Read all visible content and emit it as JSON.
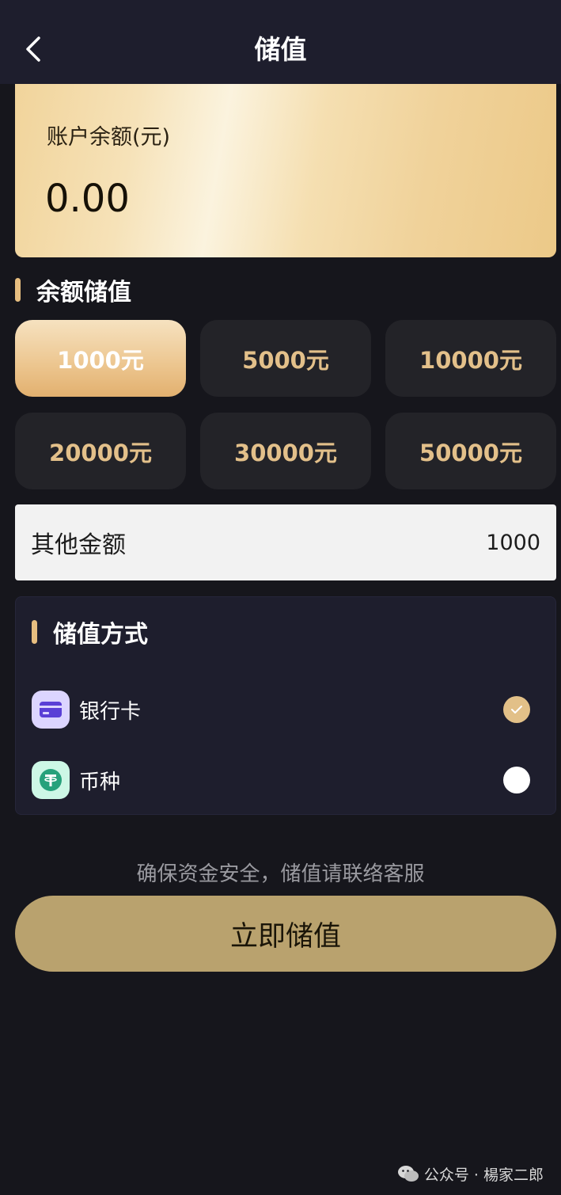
{
  "header": {
    "title": "储值",
    "back_icon": "chevron-left-icon"
  },
  "balance": {
    "label": "账户余额(元)",
    "value": "0.00"
  },
  "recharge_section": {
    "title": "余额储值",
    "amounts": [
      {
        "label": "1000元",
        "selected": true
      },
      {
        "label": "5000元",
        "selected": false
      },
      {
        "label": "10000元",
        "selected": false
      },
      {
        "label": "20000元",
        "selected": false
      },
      {
        "label": "30000元",
        "selected": false
      },
      {
        "label": "50000元",
        "selected": false
      }
    ]
  },
  "other_amount": {
    "label": "其他金额",
    "value": "1000"
  },
  "payment": {
    "title": "储值方式",
    "methods": [
      {
        "label": "银行卡",
        "icon": "bank-card-icon",
        "selected": true
      },
      {
        "label": "币种",
        "icon": "tether-coin-icon",
        "selected": false
      }
    ]
  },
  "notice": "确保资金安全，储值请联络客服",
  "submit_label": "立即储值",
  "watermark": "公众号 · 楊家二郎",
  "colors": {
    "accent_gold": "#e3c08a",
    "submit_gold": "#b9a26e",
    "background": "#16161c",
    "panel": "#1e1e2d"
  }
}
